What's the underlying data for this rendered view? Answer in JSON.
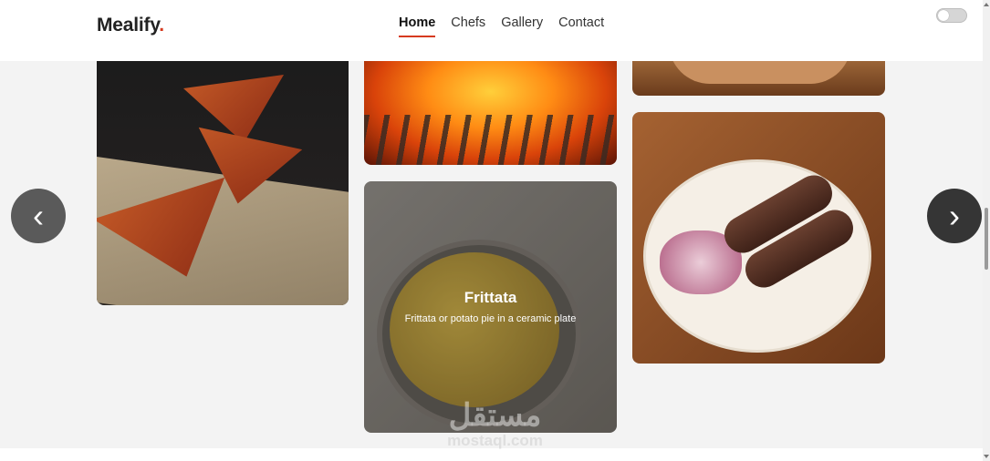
{
  "header": {
    "logo_text": "Mealify",
    "logo_dot": ".",
    "nav": [
      {
        "label": "Home",
        "active": true
      },
      {
        "label": "Chefs",
        "active": false
      },
      {
        "label": "Gallery",
        "active": false
      },
      {
        "label": "Contact",
        "active": false
      }
    ],
    "theme_toggle": {
      "state": "off"
    }
  },
  "gallery": {
    "featured": {
      "title": "Frittata",
      "description": "Frittata or potato pie in a ceramic plate"
    },
    "prev_icon": "chevron-left-icon",
    "next_icon": "chevron-right-icon",
    "prev_glyph": "‹",
    "next_glyph": "›"
  },
  "watermark": {
    "arabic": "مستقل",
    "latin": "mostaql.com"
  },
  "colors": {
    "accent": "#d63a1f",
    "background": "#f3f3f3"
  }
}
